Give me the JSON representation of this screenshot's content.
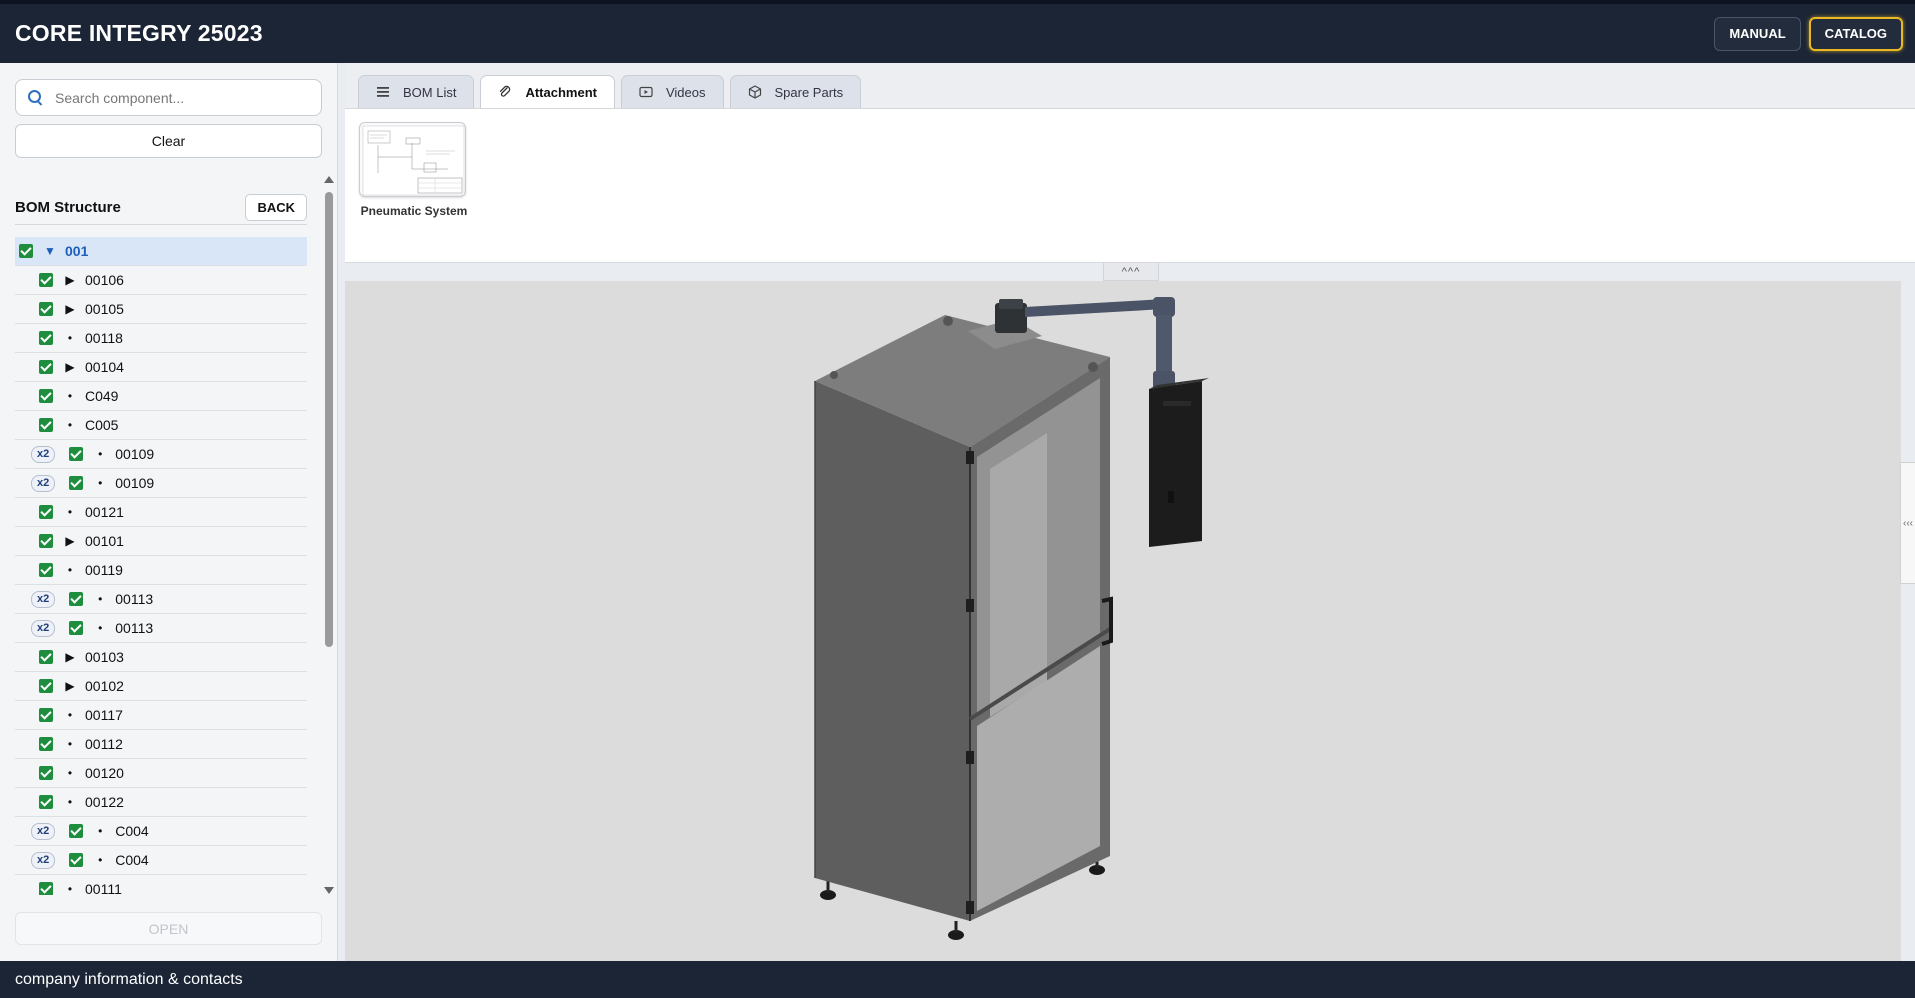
{
  "header": {
    "title": "CORE INTEGRY 25023",
    "manual_label": "MANUAL",
    "catalog_label": "CATALOG"
  },
  "sidebar": {
    "search_placeholder": "Search component...",
    "clear_label": "Clear",
    "bom_title": "BOM Structure",
    "back_label": "BACK",
    "open_label": "OPEN",
    "tree": [
      {
        "code": "001",
        "marker": "▼",
        "qty": "",
        "level": 0
      },
      {
        "code": "00106",
        "marker": "▶",
        "qty": "",
        "level": 1
      },
      {
        "code": "00105",
        "marker": "▶",
        "qty": "",
        "level": 1
      },
      {
        "code": "00118",
        "marker": "•",
        "qty": "",
        "level": 1
      },
      {
        "code": "00104",
        "marker": "▶",
        "qty": "",
        "level": 1
      },
      {
        "code": "C049",
        "marker": "•",
        "qty": "",
        "level": 1
      },
      {
        "code": "C005",
        "marker": "•",
        "qty": "",
        "level": 1
      },
      {
        "code": "00109",
        "marker": "•",
        "qty": "x2",
        "level": 1
      },
      {
        "code": "00109",
        "marker": "•",
        "qty": "x2",
        "level": 1
      },
      {
        "code": "00121",
        "marker": "•",
        "qty": "",
        "level": 1
      },
      {
        "code": "00101",
        "marker": "▶",
        "qty": "",
        "level": 1
      },
      {
        "code": "00119",
        "marker": "•",
        "qty": "",
        "level": 1
      },
      {
        "code": "00113",
        "marker": "•",
        "qty": "x2",
        "level": 1
      },
      {
        "code": "00113",
        "marker": "•",
        "qty": "x2",
        "level": 1
      },
      {
        "code": "00103",
        "marker": "▶",
        "qty": "",
        "level": 1
      },
      {
        "code": "00102",
        "marker": "▶",
        "qty": "",
        "level": 1
      },
      {
        "code": "00117",
        "marker": "•",
        "qty": "",
        "level": 1
      },
      {
        "code": "00112",
        "marker": "•",
        "qty": "",
        "level": 1
      },
      {
        "code": "00120",
        "marker": "•",
        "qty": "",
        "level": 1
      },
      {
        "code": "00122",
        "marker": "•",
        "qty": "",
        "level": 1
      },
      {
        "code": "C004",
        "marker": "•",
        "qty": "x2",
        "level": 1
      },
      {
        "code": "C004",
        "marker": "•",
        "qty": "x2",
        "level": 1
      },
      {
        "code": "00111",
        "marker": "•",
        "qty": "",
        "level": 1
      }
    ]
  },
  "tabs": [
    {
      "label": "BOM List",
      "icon": "list-icon",
      "active": false
    },
    {
      "label": "Attachment",
      "icon": "paperclip-icon",
      "active": true
    },
    {
      "label": "Videos",
      "icon": "video-icon",
      "active": false
    },
    {
      "label": "Spare Parts",
      "icon": "cube-icon",
      "active": false
    }
  ],
  "attachments": [
    {
      "label": "Pneumatic System"
    }
  ],
  "collapse_label": "^^^",
  "side_handle_label": "‹‹‹",
  "footer": {
    "text": "company information & contacts"
  },
  "colors": {
    "header_bg": "#1c2536",
    "accent": "#e8b923",
    "check": "#1e8e3e",
    "selected_row": "#d9e6f7"
  }
}
